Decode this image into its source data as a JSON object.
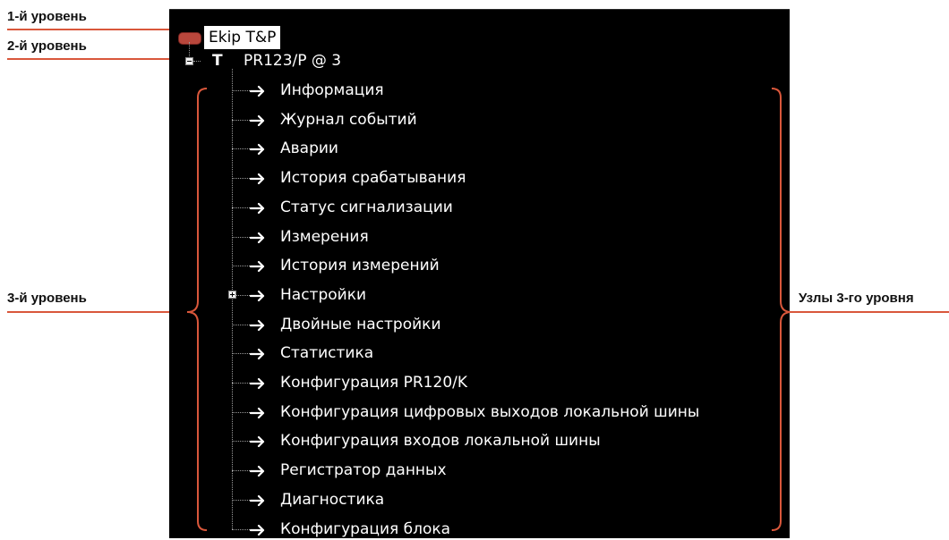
{
  "annotations": {
    "level1": "1-й уровень",
    "level2": "2-й уровень",
    "level3": "3-й уровень",
    "level3_nodes": "Узлы 3-го уровня",
    "accent_color": "#d9573b"
  },
  "tree": {
    "root": {
      "label": "Ekip T&P",
      "icon": "device-icon"
    },
    "device": {
      "label": "PR123/P @ 3",
      "icon": "t-icon",
      "expanded": true
    },
    "items": [
      {
        "label": "Информация"
      },
      {
        "label": "Журнал событий"
      },
      {
        "label": "Аварии"
      },
      {
        "label": "История срабатывания"
      },
      {
        "label": "Статус сигнализации"
      },
      {
        "label": "Измерения"
      },
      {
        "label": "История измерений"
      },
      {
        "label": "Настройки",
        "collapsed": true
      },
      {
        "label": "Двойные настройки"
      },
      {
        "label": "Статистика"
      },
      {
        "label": "Конфигурация PR120/K"
      },
      {
        "label": "Конфигурация цифровых выходов локальной шины"
      },
      {
        "label": "Конфигурация входов локальной шины"
      },
      {
        "label": "Регистратор данных"
      },
      {
        "label": "Диагностика"
      },
      {
        "label": "Конфигурация блока"
      }
    ]
  }
}
